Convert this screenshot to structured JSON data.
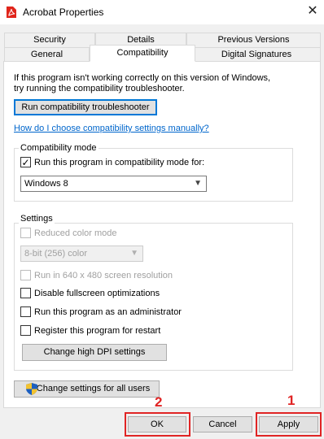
{
  "window": {
    "title": "Acrobat Properties",
    "close_glyph": "✕",
    "app_icon": "acrobat-pdf-icon"
  },
  "tabs": {
    "row1": [
      "Security",
      "Details",
      "Previous Versions"
    ],
    "row2": [
      "General",
      "Compatibility",
      "Digital Signatures"
    ],
    "active": "Compatibility"
  },
  "intro": {
    "line1": "If this program isn't working correctly on this version of Windows,",
    "line2": "try running the compatibility troubleshooter."
  },
  "troubleshooter_button": "Run compatibility troubleshooter",
  "manual_link": "How do I choose compatibility settings manually?",
  "compat_mode": {
    "label": "Compatibility mode",
    "checkbox_label": "Run this program in compatibility mode for:",
    "checked": true,
    "selected_os": "Windows 8"
  },
  "settings": {
    "label": "Settings",
    "reduced_color": "Reduced color mode",
    "color_depth": "8-bit (256) color",
    "res_640": "Run in 640 x 480 screen resolution",
    "disable_fullscreen": "Disable fullscreen optimizations",
    "run_as_admin": "Run this program as an administrator",
    "register_restart": "Register this program for restart",
    "dpi_button": "Change high DPI settings"
  },
  "all_users_button": "Change settings for all users",
  "footer": {
    "ok": "OK",
    "cancel": "Cancel",
    "apply": "Apply"
  },
  "annotations": {
    "marker_ok": "2",
    "marker_apply": "1",
    "highlight_color": "#e02424"
  },
  "colors": {
    "link": "#0066cc",
    "focus_border": "#0078d7",
    "acrobat_red": "#e0251b"
  }
}
